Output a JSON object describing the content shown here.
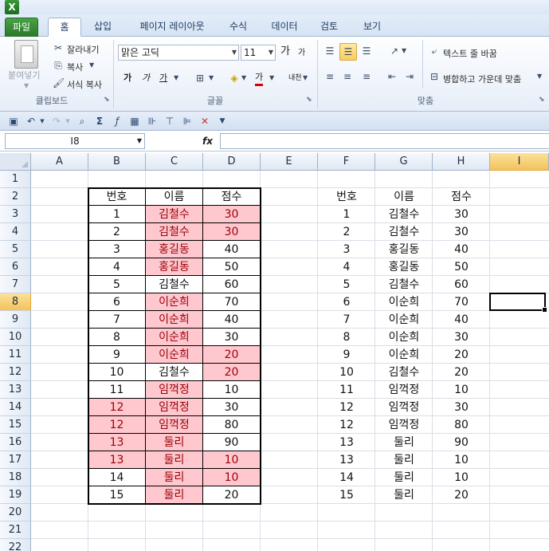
{
  "app": {
    "logo": "X"
  },
  "tabs": [
    {
      "label": "파일"
    },
    {
      "label": "홈"
    },
    {
      "label": "삽입"
    },
    {
      "label": "페이지 레이아웃"
    },
    {
      "label": "수식"
    },
    {
      "label": "데이터"
    },
    {
      "label": "검토"
    },
    {
      "label": "보기"
    }
  ],
  "ribbon": {
    "clipboard": {
      "paste": "붙여넣기",
      "cut": "잘라내기",
      "copy": "복사",
      "format_painter": "서식 복사",
      "label": "클립보드"
    },
    "font": {
      "name": "맑은 고딕",
      "size": "11",
      "grow": "가",
      "shrink": "가",
      "bold": "가",
      "italic": "가",
      "underline": "가",
      "font_color_glyph": "가",
      "phonetic": "내천",
      "label": "글꼴"
    },
    "alignment": {
      "wrap_text": "텍스트 줄 바꿈",
      "merge_center": "병합하고 가운데 맞춤",
      "label": "맞춤"
    }
  },
  "formula_bar": {
    "name_box": "I8",
    "fx": "fx",
    "value": ""
  },
  "sheet": {
    "columns": [
      "A",
      "B",
      "C",
      "D",
      "E",
      "F",
      "G",
      "H",
      "I"
    ],
    "rows": [
      "1",
      "2",
      "3",
      "4",
      "5",
      "6",
      "7",
      "8",
      "9",
      "10",
      "11",
      "12",
      "13",
      "14",
      "15",
      "16",
      "17",
      "18",
      "19",
      "20",
      "21",
      "22"
    ],
    "selected_column": "I",
    "selected_row": "8",
    "left_table": {
      "headers": [
        "번호",
        "이름",
        "점수"
      ],
      "rows": [
        {
          "num": "1",
          "name": "김철수",
          "score": "30"
        },
        {
          "num": "2",
          "name": "김철수",
          "score": "30"
        },
        {
          "num": "3",
          "name": "홍길동",
          "score": "40"
        },
        {
          "num": "4",
          "name": "홍길동",
          "score": "50"
        },
        {
          "num": "5",
          "name": "김철수",
          "score": "60"
        },
        {
          "num": "6",
          "name": "이순희",
          "score": "70"
        },
        {
          "num": "7",
          "name": "이순희",
          "score": "40"
        },
        {
          "num": "8",
          "name": "이순희",
          "score": "30"
        },
        {
          "num": "9",
          "name": "이순희",
          "score": "20"
        },
        {
          "num": "10",
          "name": "김철수",
          "score": "20"
        },
        {
          "num": "11",
          "name": "임꺽정",
          "score": "10"
        },
        {
          "num": "12",
          "name": "임꺽정",
          "score": "30"
        },
        {
          "num": "12",
          "name": "임꺽정",
          "score": "80"
        },
        {
          "num": "13",
          "name": "둘리",
          "score": "90"
        },
        {
          "num": "13",
          "name": "둘리",
          "score": "10"
        },
        {
          "num": "14",
          "name": "둘리",
          "score": "10"
        },
        {
          "num": "15",
          "name": "둘리",
          "score": "20"
        }
      ]
    },
    "right_table": {
      "headers": [
        "번호",
        "이름",
        "점수"
      ],
      "rows": [
        {
          "num": "1",
          "name": "김철수",
          "score": "30"
        },
        {
          "num": "2",
          "name": "김철수",
          "score": "30"
        },
        {
          "num": "3",
          "name": "홍길동",
          "score": "40"
        },
        {
          "num": "4",
          "name": "홍길동",
          "score": "50"
        },
        {
          "num": "5",
          "name": "김철수",
          "score": "60"
        },
        {
          "num": "6",
          "name": "이순희",
          "score": "70"
        },
        {
          "num": "7",
          "name": "이순희",
          "score": "40"
        },
        {
          "num": "8",
          "name": "이순희",
          "score": "30"
        },
        {
          "num": "9",
          "name": "이순희",
          "score": "20"
        },
        {
          "num": "10",
          "name": "김철수",
          "score": "20"
        },
        {
          "num": "11",
          "name": "임꺽정",
          "score": "10"
        },
        {
          "num": "12",
          "name": "임꺽정",
          "score": "30"
        },
        {
          "num": "12",
          "name": "임꺽정",
          "score": "80"
        },
        {
          "num": "13",
          "name": "둘리",
          "score": "90"
        },
        {
          "num": "13",
          "name": "둘리",
          "score": "10"
        },
        {
          "num": "14",
          "name": "둘리",
          "score": "10"
        },
        {
          "num": "15",
          "name": "둘리",
          "score": "20"
        }
      ]
    },
    "highlight_colors": {
      "fill": "#ffc7ce",
      "text": "#9c0006"
    }
  }
}
